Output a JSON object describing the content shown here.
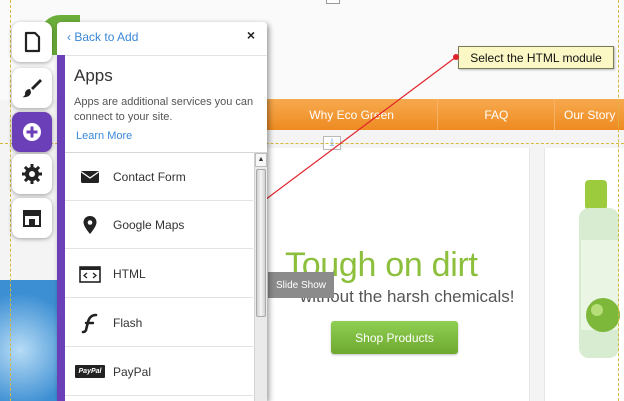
{
  "website": {
    "nav": [
      "Why Eco Green",
      "FAQ",
      "Our Story"
    ],
    "hero_title": "Tough on dirt",
    "hero_subtitle": "without the harsh chemicals!",
    "shop_button": "Shop Products",
    "slideshow_label": "Slide Show",
    "colors": {
      "nav": "#ef8e26",
      "hero_title": "#8cbf3c",
      "shop_button": "#7fbc3e"
    }
  },
  "callout": {
    "text": "Select the HTML module",
    "arrow_color": "#e0242a"
  },
  "toolbar": {
    "active_tool": "add",
    "accent": "#6b3fb7",
    "tools": [
      {
        "name": "pages",
        "icon": "page-icon"
      },
      {
        "name": "design",
        "icon": "paintbrush-icon"
      },
      {
        "name": "add",
        "icon": "plus-icon"
      },
      {
        "name": "settings",
        "icon": "gear-icon"
      },
      {
        "name": "market",
        "icon": "store-icon"
      }
    ]
  },
  "panel": {
    "back_label": "Back to Add",
    "close_label": "×",
    "title": "Apps",
    "description": "Apps are additional services you can connect to your site.",
    "learn_more": "Learn More",
    "items": [
      {
        "label": "Contact Form",
        "icon": "envelope-icon"
      },
      {
        "label": "Google Maps",
        "icon": "map-pin-icon"
      },
      {
        "label": "HTML",
        "icon": "html-code-icon"
      },
      {
        "label": "Flash",
        "icon": "flash-icon"
      },
      {
        "label": "PayPal",
        "icon": "paypal-icon",
        "badge": "PayPal"
      }
    ]
  }
}
